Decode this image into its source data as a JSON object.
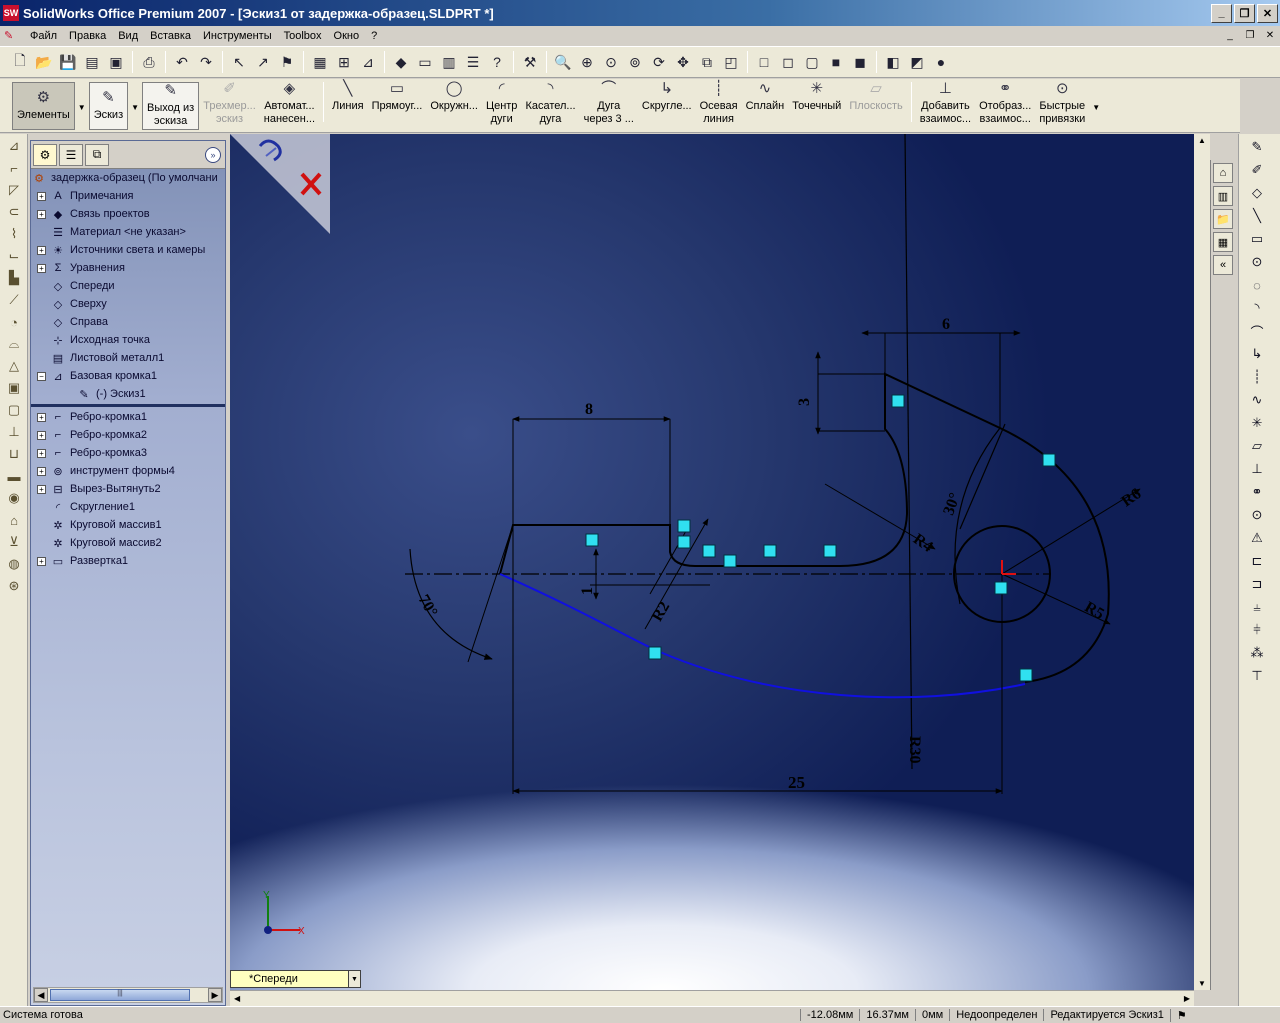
{
  "window": {
    "title": "SolidWorks Office Premium 2007 - [Эскиз1 от задержка-образец.SLDPRT *]",
    "app_icon": "sw-logo-icon",
    "buttons": [
      "_",
      "❐",
      "✕"
    ]
  },
  "menubar": {
    "items": [
      "Файл",
      "Правка",
      "Вид",
      "Вставка",
      "Инструменты",
      "Toolbox",
      "Окно",
      "?"
    ],
    "mdi_buttons": [
      "_",
      "❐",
      "✕"
    ]
  },
  "commandmanager": {
    "elements": "Элементы",
    "sketch": "Эскиз",
    "exit_sketch": [
      "Выход из",
      "эскиза"
    ],
    "sketch3d": [
      "Трехмер...",
      "эскиз"
    ],
    "auto_dim": [
      "Автомат...",
      "нанесен..."
    ],
    "line": "Линия",
    "rect": "Прямоуг...",
    "circle": "Окружн...",
    "center_arc": [
      "Центр",
      "дуги"
    ],
    "tangent_arc": [
      "Касател...",
      "дуга"
    ],
    "three_point_arc": [
      "Дуга",
      "через 3 ..."
    ],
    "fillet": "Скругле...",
    "centerline": [
      "Осевая",
      "линия"
    ],
    "spline": "Сплайн",
    "point": "Точечный",
    "plane": "Плоскость",
    "add_relation": [
      "Добавить",
      "взаимос..."
    ],
    "display_relation": [
      "Отобраз...",
      "взаимос..."
    ],
    "quick_snaps": [
      "Быстрые",
      "привязки"
    ]
  },
  "feature_tree": {
    "root": "задержка-образец  (По умолчани",
    "items": [
      {
        "label": "Примечания",
        "icon": "annotation-icon",
        "expand": true
      },
      {
        "label": "Связь проектов",
        "icon": "design-binder-icon",
        "expand": true
      },
      {
        "label": "Материал <не указан>",
        "icon": "material-icon",
        "expand": false
      },
      {
        "label": "Источники света и камеры",
        "icon": "lights-icon",
        "expand": true
      },
      {
        "label": "Уравнения",
        "icon": "equations-icon",
        "expand": true
      },
      {
        "label": "Спереди",
        "icon": "plane-icon",
        "expand": false
      },
      {
        "label": "Сверху",
        "icon": "plane-icon",
        "expand": false
      },
      {
        "label": "Справа",
        "icon": "plane-icon",
        "expand": false
      },
      {
        "label": "Исходная точка",
        "icon": "origin-icon",
        "expand": false
      },
      {
        "label": "Листовой металл1",
        "icon": "sheet-metal-icon",
        "expand": false
      },
      {
        "label": "Базовая кромка1",
        "icon": "base-flange-icon",
        "expand": "open"
      },
      {
        "label": "(-) Эскиз1",
        "icon": "sketch-icon",
        "expand": false,
        "indent": true
      }
    ],
    "after_rollback": [
      {
        "label": "Ребро-кромка1",
        "icon": "edge-flange-icon"
      },
      {
        "label": "Ребро-кромка2",
        "icon": "edge-flange-icon"
      },
      {
        "label": "Ребро-кромка3",
        "icon": "edge-flange-icon"
      },
      {
        "label": "инструмент формы4",
        "icon": "forming-tool-icon"
      },
      {
        "label": "Вырез-Вытянуть2",
        "icon": "cut-extrude-icon"
      },
      {
        "label": "Скругление1",
        "icon": "fillet-icon",
        "noexpand": true
      },
      {
        "label": "Круговой массив1",
        "icon": "pattern-icon",
        "noexpand": true
      },
      {
        "label": "Круговой массив2",
        "icon": "pattern-icon",
        "noexpand": true
      },
      {
        "label": "Развертка1",
        "icon": "flatten-icon"
      }
    ]
  },
  "sketch": {
    "dims": {
      "d6": "6",
      "d8": "8",
      "d3": "3",
      "d1": "1",
      "d25": "25",
      "r2": "R2",
      "r4": "R4",
      "r30": "R30",
      "r6": "R6",
      "r5": "R5",
      "a70": "70°",
      "a30": "30°"
    },
    "axis_labels": {
      "x": "X",
      "y": "Y"
    }
  },
  "view_label": "*Спереди",
  "statusbar": {
    "message": "Система готова",
    "x": "-12.08мм",
    "y": "16.37мм",
    "z": "0мм",
    "state": "Недоопределен",
    "mode": "Редактируется Эскиз1"
  },
  "colors": {
    "sketch_black": "#000000",
    "sketch_blue": "#1010e0",
    "relation_cyan": "#30e0f0",
    "cancel_red": "#d01010"
  }
}
